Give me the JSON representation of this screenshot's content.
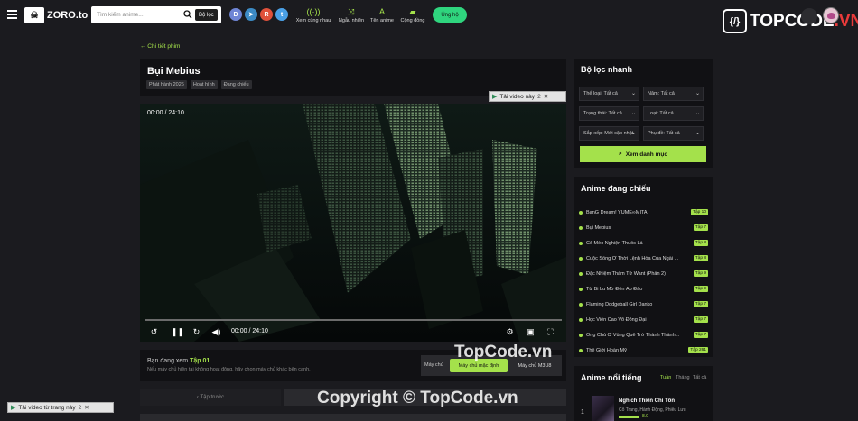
{
  "colors": {
    "accent": "#a4e14b",
    "donate": "#2fd57e",
    "background": "#1b1b1f",
    "card": "#111114"
  },
  "header": {
    "logo_text": "ZORO.to",
    "search_placeholder": "Tìm kiếm anime...",
    "filter_label": "Bộ lọc",
    "social": [
      {
        "icon": "discord-icon",
        "color": "#6f85d5",
        "glyph": "D"
      },
      {
        "icon": "telegram-icon",
        "color": "#3c8bc5",
        "glyph": "➤"
      },
      {
        "icon": "reddit-icon",
        "color": "#e0513b",
        "glyph": "R"
      },
      {
        "icon": "twitter-icon",
        "color": "#4aa0e6",
        "glyph": "t"
      }
    ],
    "nav": [
      {
        "label": "Xem cùng nhau",
        "icon": "broadcast-icon",
        "glyph": "((·))"
      },
      {
        "label": "Ngẫu nhiên",
        "icon": "shuffle-icon",
        "glyph": "⤨"
      },
      {
        "label": "Tên anime",
        "icon": "lang-icon",
        "glyph": "A"
      },
      {
        "label": "Cộng đồng",
        "icon": "chat-icon",
        "glyph": "💬"
      }
    ],
    "donate_label": "Ủng hộ",
    "brand_box": "{/}",
    "brand_main": "TOPCODE",
    "brand_dot": ".VN"
  },
  "main": {
    "back_link": "← Chi tiết phim",
    "title": "Bụi Mebius",
    "tags": [
      "Phát hành 2026",
      "Hoạt hình",
      "Đang chiếu"
    ],
    "player": {
      "time_top": "00:00 / 24:10",
      "time_bottom": "00:00 / 24:10",
      "progress": 0
    },
    "float_video": {
      "label": "Tải video này",
      "num": "2",
      "close": "✕"
    },
    "float_video_page": {
      "label": "Tải video từ trang này",
      "num": "2",
      "close": "✕"
    },
    "watching_prefix": "Bạn đang xem",
    "watching_ep": "Tập 01",
    "server_note": "Nếu máy chủ hiện tại không hoạt động, hãy chọn máy chủ khác bên cạnh.",
    "server_label": "Máy chủ",
    "server_default": "Máy chủ mặc định",
    "server_m3u8": "Máy chủ M3U8",
    "prev_label": "‹ Tập trước",
    "watermark_center": "TopCode.vn",
    "watermark_bottom": "Copyright © TopCode.vn"
  },
  "sidebar": {
    "quick_filter": {
      "title": "Bộ lọc nhanh",
      "selects": [
        "Thể loại: Tất cả",
        "Năm: Tất cả",
        "Trạng thái: Tất cả",
        "Loại: Tất cả",
        "Sắp xếp: Mới cập nhật",
        "Phụ đề: Tất cả"
      ],
      "submit": "Xem danh mục"
    },
    "airing": {
      "title": "Anime đang chiếu",
      "items": [
        {
          "name": "BanG Dream! YUME∞MITA",
          "ep": "Tập 10"
        },
        {
          "name": "Bụi Mebius",
          "ep": "Tập 7"
        },
        {
          "name": "Cô Mèo Nghiện Thuốc Lá",
          "ep": "Tập 8"
        },
        {
          "name": "Cuộc Sống Ở Thời Lệnh Hòa Của Ngài ...",
          "ep": "Tập 8"
        },
        {
          "name": "Đặc Nhiệm Thám Tử Want (Phần 2)",
          "ep": "Tập 9"
        },
        {
          "name": "Từ Bi Lu Mờ Đến Áp Đảo",
          "ep": "Tập 9"
        },
        {
          "name": "Flaming Dodgeball Girl Danko",
          "ep": "Tập 7"
        },
        {
          "name": "Học Viện Cao Võ Đông Đại",
          "ep": "Tập 7"
        },
        {
          "name": "Ông Chú Ở Vùng Quê Trở Thành Thánh...",
          "ep": "Tập 7"
        },
        {
          "name": "Thế Giới Hoàn Mỹ",
          "ep": "Tập 261"
        }
      ]
    },
    "popular": {
      "title": "Anime nổi tiếng",
      "tabs": [
        "Tuần",
        "Tháng",
        "Tất cả"
      ],
      "top": {
        "rank": "1",
        "name": "Nghịch Thiên Chí Tôn",
        "genre": "Cổ Trang, Hành Động, Phiêu Lưu",
        "score": "8.0"
      }
    }
  }
}
